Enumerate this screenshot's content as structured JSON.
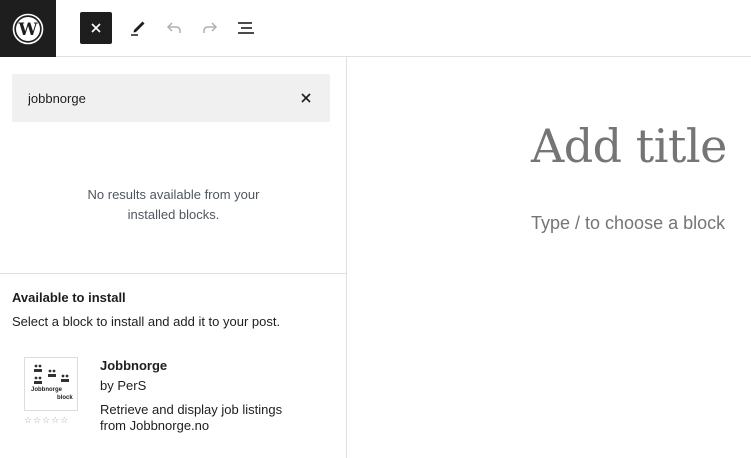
{
  "toolbar": {
    "logo_icon": "wordpress-logo-icon",
    "close_icon": "close-icon",
    "tools_icon": "pencil-icon",
    "undo_icon": "undo-icon",
    "redo_icon": "redo-icon",
    "list_view_icon": "list-view-icon"
  },
  "inserter": {
    "search": {
      "value": "jobbnorge",
      "clear_icon": "close-icon"
    },
    "no_results_line1": "No results available from your",
    "no_results_line2": "installed blocks.",
    "available_title": "Available to install",
    "available_desc": "Select a block to install and add it to your post.",
    "block": {
      "name": "Jobbnorge",
      "author": "by PerS",
      "description_line1": "Retrieve and display job listings",
      "description_line2": "from Jobbnorge.no",
      "thumb_label_1": "Jobbnorge",
      "thumb_label_2": "block",
      "rating": 0,
      "stars": "☆☆☆☆☆"
    }
  },
  "canvas": {
    "title_placeholder": "Add title",
    "block_prompt": "Type / to choose a block"
  },
  "colors": {
    "dark": "#1e1e1e",
    "placeholder": "#757575",
    "border": "#e0e0e0",
    "search_bg": "#f0f0f0"
  }
}
